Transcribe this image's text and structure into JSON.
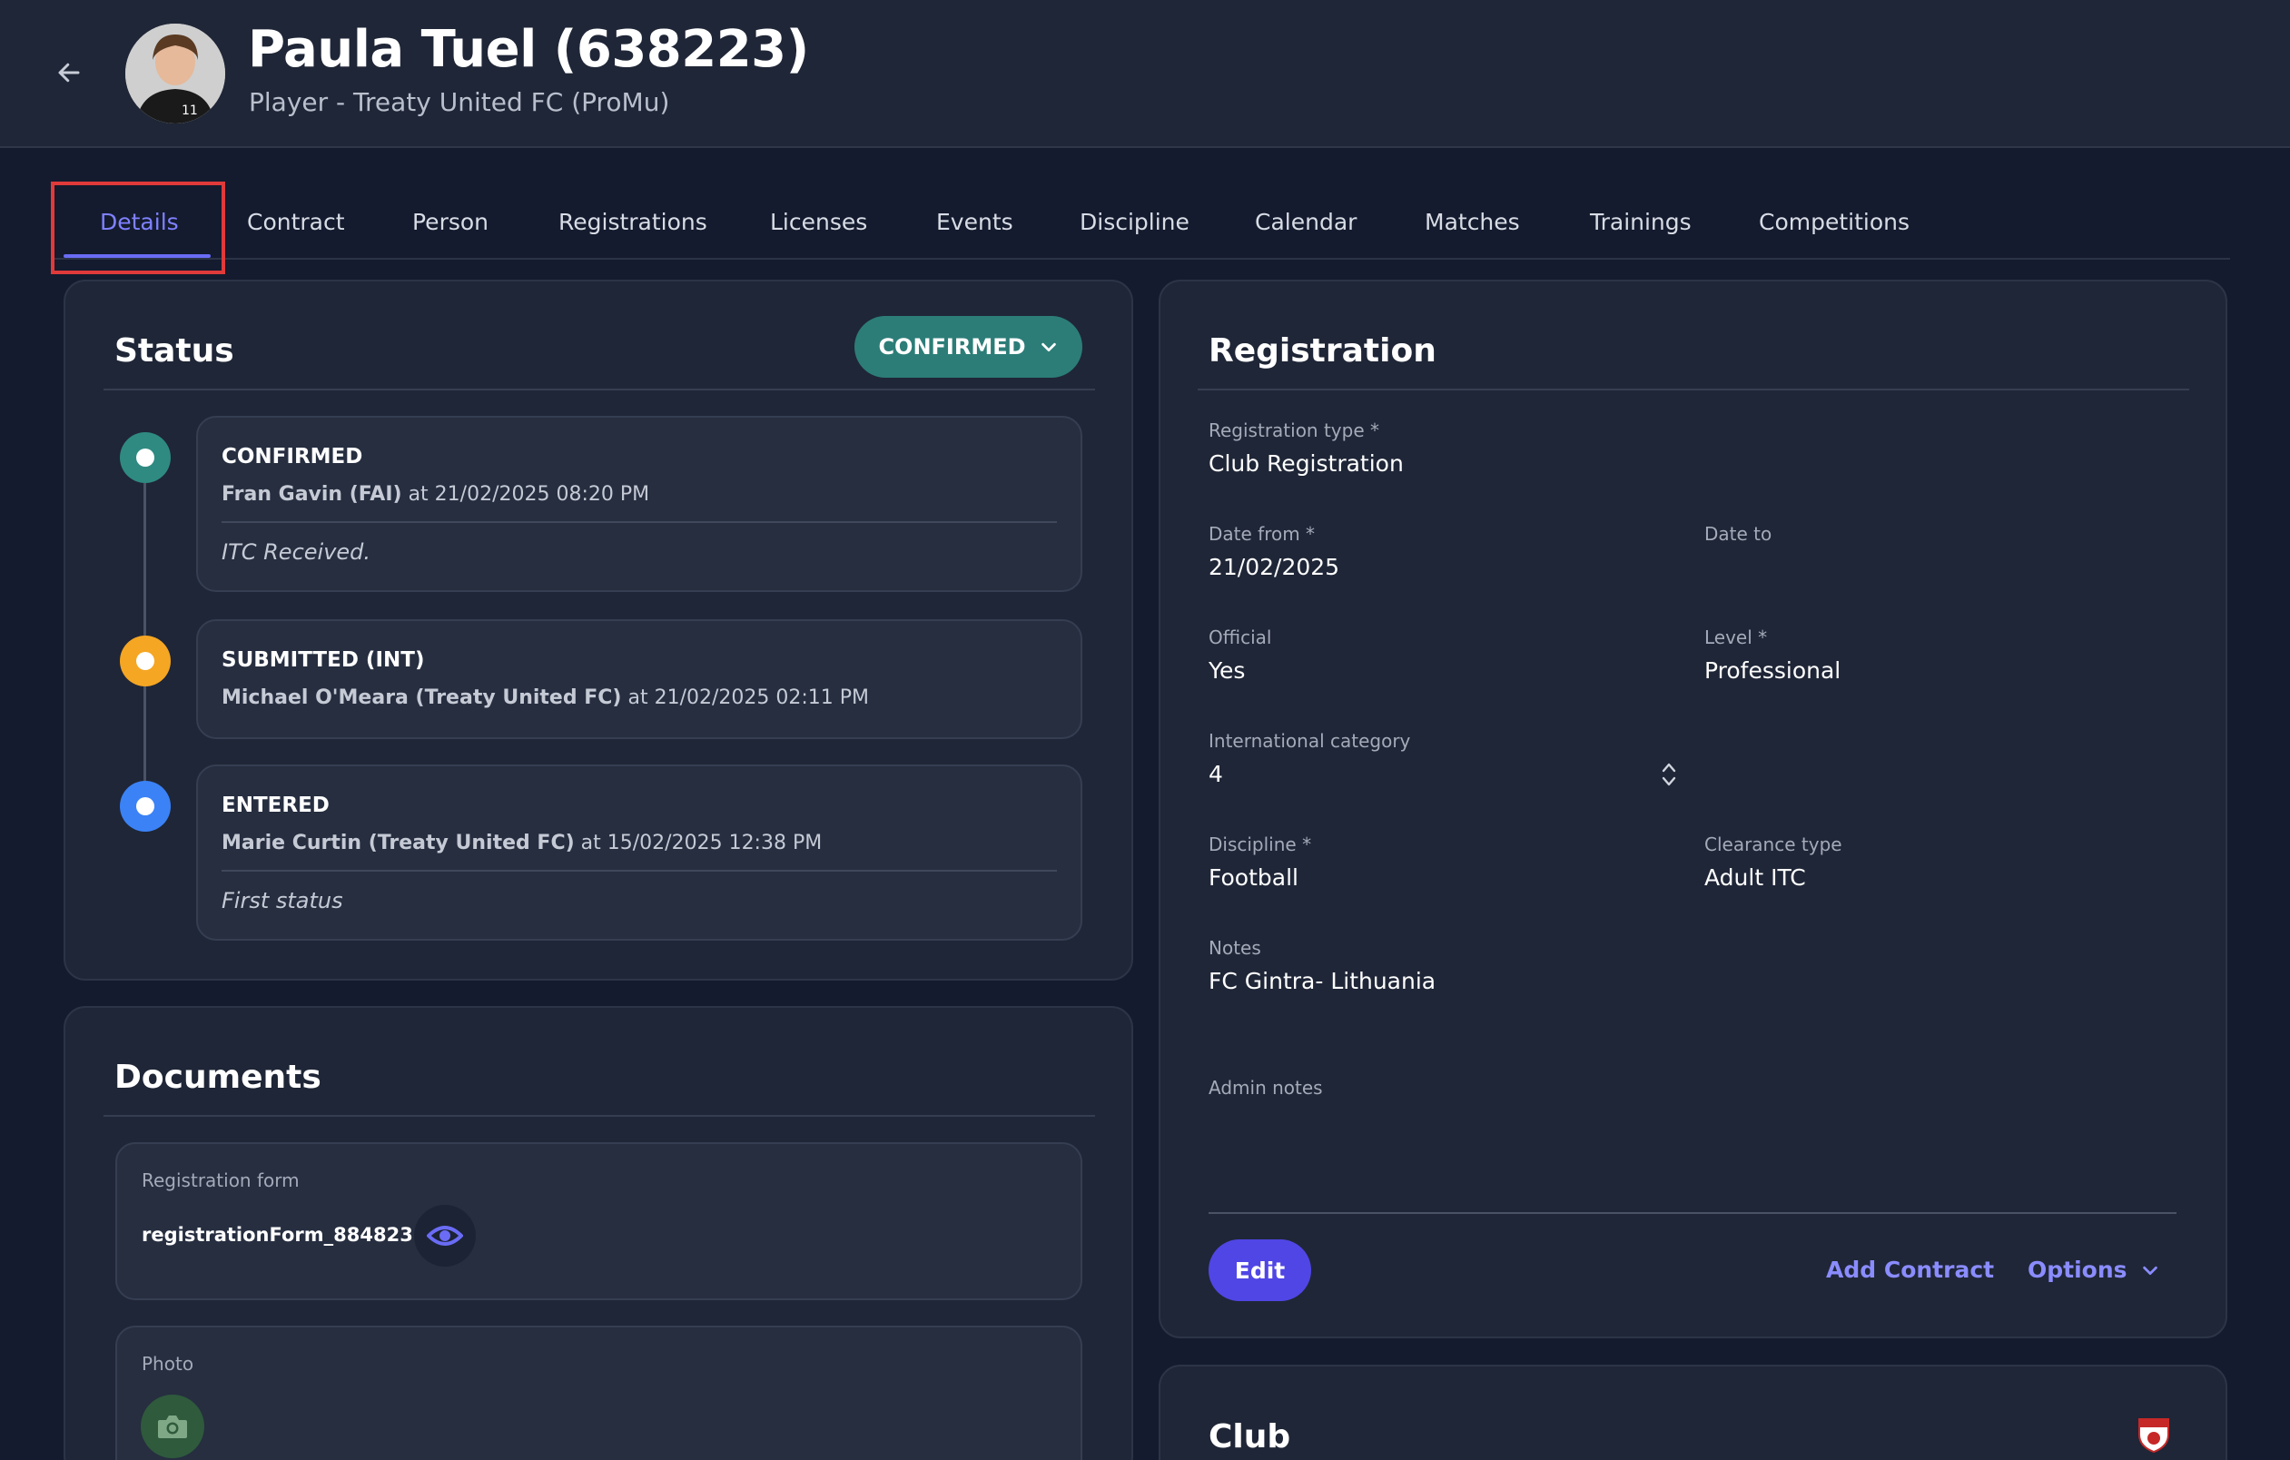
{
  "header": {
    "title": "Paula Tuel (638223)",
    "subtitle": "Player - Treaty United FC (ProMu)",
    "back_icon": "arrow-left-icon"
  },
  "tabs": [
    {
      "label": "Details",
      "active": true
    },
    {
      "label": "Contract"
    },
    {
      "label": "Person"
    },
    {
      "label": "Registrations"
    },
    {
      "label": "Licenses"
    },
    {
      "label": "Events"
    },
    {
      "label": "Discipline"
    },
    {
      "label": "Calendar"
    },
    {
      "label": "Matches"
    },
    {
      "label": "Trainings"
    },
    {
      "label": "Competitions"
    }
  ],
  "status": {
    "title": "Status",
    "current": "CONFIRMED",
    "entries": [
      {
        "title": "CONFIRMED",
        "user": "Fran Gavin (FAI)",
        "at": "at 21/02/2025 08:20 PM",
        "note": "ITC Received.",
        "color": "#2f8a82"
      },
      {
        "title": "SUBMITTED (INT)",
        "user": "Michael O'Meara (Treaty United FC)",
        "at": "at 21/02/2025 02:11 PM",
        "note": "",
        "color": "#f5a623"
      },
      {
        "title": "ENTERED",
        "user": "Marie Curtin (Treaty United FC)",
        "at": "at 15/02/2025 12:38 PM",
        "note": "First status",
        "color": "#3b82f6"
      }
    ]
  },
  "documents": {
    "title": "Documents",
    "registration_form_label": "Registration form",
    "registration_form_file": "registrationForm_884823.pdf",
    "photo_label": "Photo"
  },
  "registration": {
    "title": "Registration",
    "type_label": "Registration type *",
    "type_value": "Club Registration",
    "date_from_label": "Date from *",
    "date_from_value": "21/02/2025",
    "date_to_label": "Date to",
    "date_to_value": "",
    "official_label": "Official",
    "official_value": "Yes",
    "level_label": "Level *",
    "level_value": "Professional",
    "intl_category_label": "International category",
    "intl_category_value": "4",
    "discipline_label": "Discipline *",
    "discipline_value": "Football",
    "clearance_label": "Clearance type",
    "clearance_value": "Adult ITC",
    "notes_label": "Notes",
    "notes_value": "FC Gintra- Lithuania",
    "admin_notes_label": "Admin notes",
    "admin_notes_value": "",
    "edit_label": "Edit",
    "add_contract_label": "Add Contract",
    "options_label": "Options"
  },
  "club": {
    "title": "Club"
  },
  "colors": {
    "accent": "#5046e5",
    "link": "#8a8cff",
    "confirmed": "#2c7d78"
  }
}
